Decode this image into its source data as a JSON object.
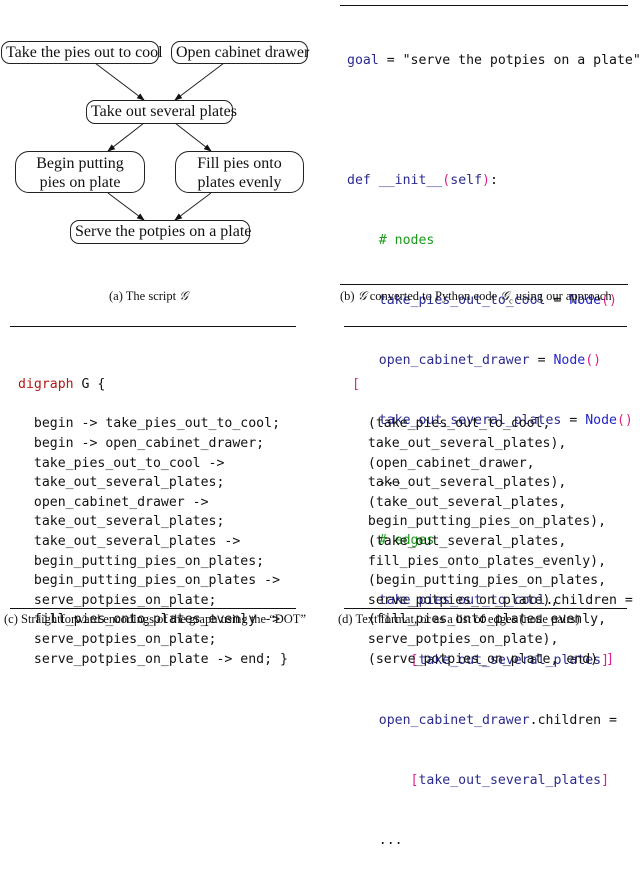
{
  "panel_a": {
    "nodes": {
      "take_pies": "Take the pies out to cool",
      "open_cabinet": "Open cabinet drawer",
      "take_out_plates": "Take out several plates",
      "begin_putting_l1": "Begin putting",
      "begin_putting_l2": "pies on plate",
      "fill_pies_l1": "Fill pies onto",
      "fill_pies_l2": "plates evenly",
      "serve": "Serve the potpies on a plate"
    },
    "edges": [
      [
        "take_pies",
        "take_out_plates"
      ],
      [
        "open_cabinet",
        "take_out_plates"
      ],
      [
        "take_out_plates",
        "begin_putting"
      ],
      [
        "take_out_plates",
        "fill_pies"
      ],
      [
        "begin_putting",
        "serve"
      ],
      [
        "fill_pies",
        "serve"
      ]
    ],
    "caption_prefix": "(a) The script ",
    "caption_symbol": "𝒢"
  },
  "panel_b": {
    "lines": {
      "goal_var": "goal",
      "goal_eq": " = ",
      "goal_str": "\"serve the potpies on a plate\"",
      "def_kw": "def",
      "init_name": " __init__",
      "init_open": "(",
      "init_self": "self",
      "init_close": ")",
      "init_colon": ":",
      "comment_nodes": "    # nodes",
      "n1_name": "    take_pies_out_to_cool",
      "n2_name": "    open_cabinet_drawer",
      "n3_name": "    take_out_several_plates",
      "assign": " = ",
      "node_call": "Node",
      "parens": "()",
      "ellipsis": "    ...",
      "comment_edges": "    # edges",
      "e1_src": "    take_pies_out_to_cool",
      "e2_src": "    open_cabinet_drawer",
      "children_attr": ".children =",
      "indent2": "        ",
      "lb": "[",
      "rb": "]",
      "e_target": "take_out_several_plates"
    },
    "caption_prefix": "(b) ",
    "caption_symbol": "𝒢",
    "caption_mid": " converted to Python code ",
    "caption_symbol2": "𝒢",
    "caption_sub": "c",
    "caption_suffix": " using our approach"
  },
  "panel_c": {
    "header_kw": "digraph",
    "header_rest": " G {",
    "lines": [
      "  begin -> take_pies_out_to_cool;",
      "  begin -> open_cabinet_drawer;",
      "  take_pies_out_to_cool ->",
      "  take_out_several_plates;",
      "  open_cabinet_drawer ->",
      "  take_out_several_plates;",
      "  take_out_several_plates ->",
      "  begin_putting_pies_on_plates;",
      "  begin_putting_pies_on_plates ->",
      "  serve_potpies_on_plate;",
      "  fill_pies_onto_plates_evenly ->",
      "  serve_potpies_on_plate;",
      "  serve_potpies_on_plate -> end; }"
    ],
    "caption": "(c) Straightforward encodings of the graph using the “DOT”"
  },
  "panel_d": {
    "open_bracket": "[",
    "lines": [
      "  (take_pies_out_to_cool,",
      "  take_out_several_plates),",
      "  (open_cabinet_drawer,",
      "  take_out_several_plates),",
      "  (take_out_several_plates,",
      "  begin_putting_pies_on_plates),",
      "  (take_out_several_plates,",
      "  fill_pies_onto_plates_evenly),",
      "  (begin_putting_pies_on_plates,",
      "  serve_potpies_on_plate),",
      "  (fill_pies_onto_plates_evenly,",
      "  serve_potpies_on_plate),"
    ],
    "last_line": "  (serve_potpies_on_plate, end) ",
    "close_bracket": "]",
    "caption": "(d) Text format, or as a list of edges (node pairs)"
  }
}
